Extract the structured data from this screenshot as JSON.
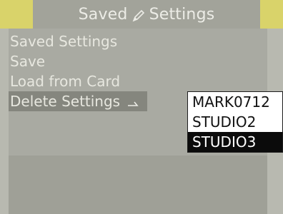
{
  "header": {
    "title_left": "Saved",
    "title_right": "Settings",
    "icon": "pencil-icon"
  },
  "menu": {
    "items": [
      {
        "label": "Saved Settings"
      },
      {
        "label": "Save"
      },
      {
        "label": "Load from Card"
      },
      {
        "label": "Delete Settings",
        "selected": true
      }
    ]
  },
  "popup": {
    "items": [
      {
        "label": "MARK0712"
      },
      {
        "label": "STUDIO2"
      },
      {
        "label": "STUDIO3",
        "selected": true
      }
    ]
  },
  "colors": {
    "accent": "#d9d36a",
    "background": "#a9aaa2",
    "selected_row": "#85867e",
    "popup_selected": "#0b0b0b"
  }
}
